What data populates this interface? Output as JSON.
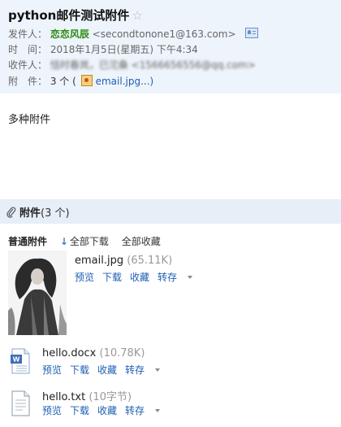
{
  "subject": {
    "title": "python邮件测试附件",
    "star": "☆"
  },
  "meta": {
    "sender_label": "发件人：",
    "sender_name": "恋恋风辰",
    "sender_address": "<secondtonone1@163.com>",
    "time_label": "时　间：",
    "time_value": "2018年1月5日(星期五) 下午4:34",
    "recipient_label": "收件人：",
    "recipient_value": "恬时春岚，已沱桑 <1566656556@qq.com>",
    "attachment_label": "附　件：",
    "attachment_count": "3 个 (",
    "attachment_first": "email.jpg...)"
  },
  "body": {
    "text": "多种附件"
  },
  "attachments": {
    "header_label": "附件",
    "header_count": "(3 个)",
    "toolbar_title": "普通附件",
    "download_all": "全部下载",
    "collect_all": "全部收藏",
    "files": [
      {
        "name": "email.jpg",
        "size": "(65.11K)",
        "type": "image"
      },
      {
        "name": "hello.docx",
        "size": "(10.78K)",
        "type": "word"
      },
      {
        "name": "hello.txt",
        "size": "(10字节)",
        "type": "text"
      }
    ],
    "actions": {
      "preview": "预览",
      "download": "下载",
      "collect": "收藏",
      "forward": "转存"
    }
  },
  "colors": {
    "header_bg": "#eef4fb",
    "sender_name": "#2a8a12",
    "link": "#1e5fb4",
    "bar_bg": "#e6eef7"
  }
}
